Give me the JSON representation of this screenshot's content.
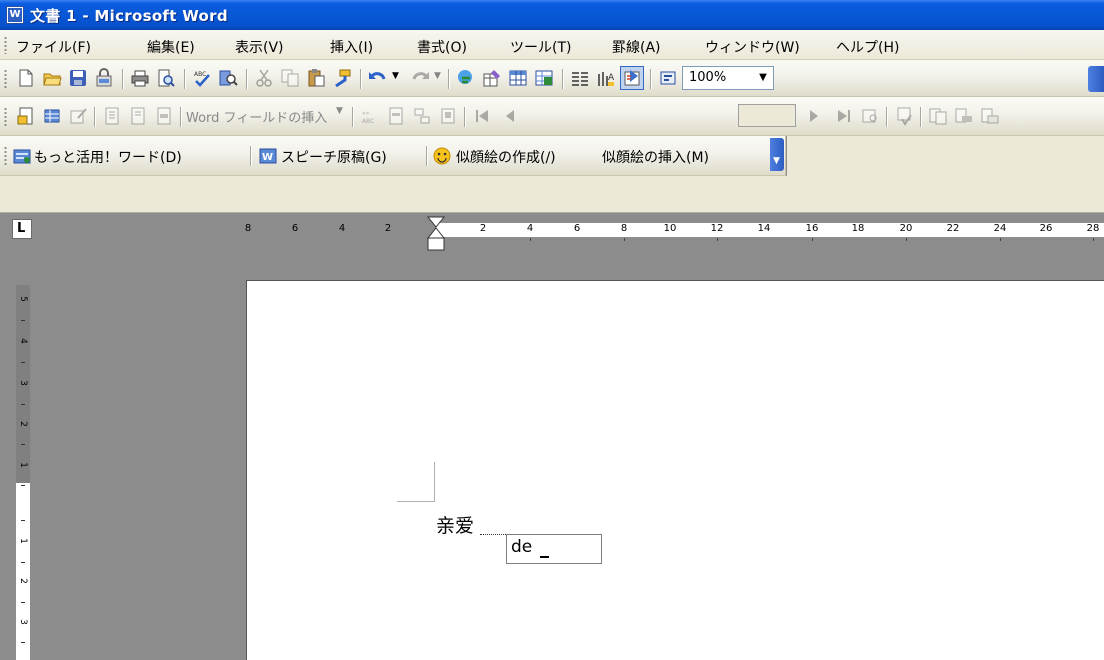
{
  "window": {
    "title": "文書 1 - Microsoft Word",
    "icon": "word-app-icon"
  },
  "menubar": {
    "items": [
      {
        "label": "ファイル(F)"
      },
      {
        "label": "編集(E)"
      },
      {
        "label": "表示(V)"
      },
      {
        "label": "挿入(I)"
      },
      {
        "label": "書式(O)"
      },
      {
        "label": "ツール(T)"
      },
      {
        "label": "罫線(A)"
      },
      {
        "label": "ウィンドウ(W)"
      },
      {
        "label": "ヘルプ(H)"
      }
    ]
  },
  "standard_toolbar": {
    "zoom": "100%",
    "icons": [
      "new-document-icon",
      "open-folder-icon",
      "save-icon",
      "permission-icon",
      "print-icon",
      "print-preview-icon",
      "spelling-icon",
      "research-icon",
      "cut-icon",
      "copy-icon",
      "paste-icon",
      "format-painter-icon",
      "undo-icon",
      "redo-icon",
      "hyperlink-icon",
      "tables-borders-icon",
      "insert-table-icon",
      "insert-excel-icon",
      "columns-icon",
      "drawing-icon",
      "document-map-icon",
      "show-formatting-icon"
    ]
  },
  "mailmerge_toolbar": {
    "insert_word_field": "Word フィールドの挿入"
  },
  "custom_toolbar": {
    "items": [
      {
        "label": "もっと活用！ワード(D)"
      },
      {
        "label": "スピーチ原稿(G)"
      },
      {
        "label": "似顔絵の作成(/)"
      },
      {
        "label": "似顔絵の挿入(M)"
      }
    ]
  },
  "ruler": {
    "tab_selector": "L",
    "h_left_numbers": [
      "8",
      "6",
      "4",
      "2"
    ],
    "h_right_numbers": [
      "2",
      "4",
      "6",
      "8",
      "10",
      "12",
      "14",
      "16",
      "18",
      "20",
      "22",
      "24",
      "26",
      "28"
    ],
    "v_numbers": [
      "5",
      "4",
      "3",
      "2",
      "1",
      "1",
      "2",
      "3"
    ]
  },
  "document": {
    "text": "亲爱",
    "ime_composition": "de"
  },
  "colors": {
    "titlebar": "#0757d6",
    "menubar": "#ece9d8",
    "workspace": "#8c8c8c",
    "page": "#ffffff"
  }
}
